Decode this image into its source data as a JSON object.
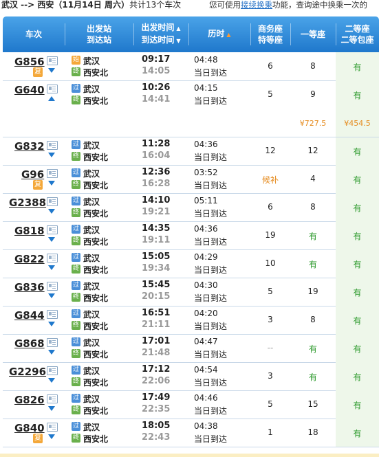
{
  "header": {
    "route_title": "武汉 --> 西安（11月14日 周六）",
    "count_text": "共计13个车次",
    "tip_prefix": "您可使用",
    "tip_link": "接续换乘",
    "tip_suffix": "功能，查询途中换乘一次的"
  },
  "columns": {
    "train": "车次",
    "from": "出发站",
    "to": "到达站",
    "dep_time": "出发时间",
    "arr_time": "到达时间",
    "duration": "历时",
    "biz1": "商务座",
    "biz2": "特等座",
    "first": "一等座",
    "second1": "二等座",
    "second2": "二等包座"
  },
  "icons": {
    "detail": "detail-doc-icon",
    "expand": "chevron-down-icon",
    "collapse": "chevron-up-icon",
    "fu": "复",
    "guo": "过",
    "shi": "始",
    "zhong": "终"
  },
  "prices": {
    "first": "¥727.5",
    "second": "¥454.5"
  },
  "trains": [
    {
      "no": "G856",
      "fu": true,
      "arrow": "down",
      "start": "始",
      "from": "武汉",
      "to": "西安北",
      "dep": "09:17",
      "arr": "14:05",
      "dur": "04:48",
      "day": "当日到达",
      "biz": "6",
      "bizc": "",
      "one": "8",
      "onec": "",
      "two": "有"
    },
    {
      "no": "G640",
      "fu": false,
      "arrow": "up",
      "start": "过",
      "from": "武汉",
      "to": "西安北",
      "dep": "10:26",
      "arr": "14:41",
      "dur": "04:15",
      "day": "当日到达",
      "biz": "5",
      "bizc": "",
      "one": "9",
      "onec": "",
      "two": "有"
    },
    {
      "no": "G832",
      "fu": false,
      "arrow": "down",
      "start": "过",
      "from": "武汉",
      "to": "西安北",
      "dep": "11:28",
      "arr": "16:04",
      "dur": "04:36",
      "day": "当日到达",
      "biz": "12",
      "bizc": "",
      "one": "12",
      "onec": "",
      "two": "有"
    },
    {
      "no": "G96",
      "fu": true,
      "arrow": "down",
      "start": "过",
      "from": "武汉",
      "to": "西安北",
      "dep": "12:36",
      "arr": "16:28",
      "dur": "03:52",
      "day": "当日到达",
      "biz": "候补",
      "bizc": "orange",
      "one": "4",
      "onec": "",
      "two": "有"
    },
    {
      "no": "G2388",
      "fu": false,
      "arrow": "down",
      "start": "过",
      "from": "武汉",
      "to": "西安北",
      "dep": "14:10",
      "arr": "19:21",
      "dur": "05:11",
      "day": "当日到达",
      "biz": "6",
      "bizc": "",
      "one": "8",
      "onec": "",
      "two": "有"
    },
    {
      "no": "G818",
      "fu": false,
      "arrow": "down",
      "start": "过",
      "from": "武汉",
      "to": "西安北",
      "dep": "14:35",
      "arr": "19:11",
      "dur": "04:36",
      "day": "当日到达",
      "biz": "19",
      "bizc": "",
      "one": "有",
      "onec": "green",
      "two": "有"
    },
    {
      "no": "G822",
      "fu": false,
      "arrow": "down",
      "start": "过",
      "from": "武汉",
      "to": "西安北",
      "dep": "15:05",
      "arr": "19:34",
      "dur": "04:29",
      "day": "当日到达",
      "biz": "10",
      "bizc": "",
      "one": "有",
      "onec": "green",
      "two": "有"
    },
    {
      "no": "G836",
      "fu": false,
      "arrow": "down",
      "start": "过",
      "from": "武汉",
      "to": "西安北",
      "dep": "15:45",
      "arr": "20:15",
      "dur": "04:30",
      "day": "当日到达",
      "biz": "5",
      "bizc": "",
      "one": "19",
      "onec": "",
      "two": "有"
    },
    {
      "no": "G844",
      "fu": false,
      "arrow": "down",
      "start": "过",
      "from": "武汉",
      "to": "西安北",
      "dep": "16:51",
      "arr": "21:11",
      "dur": "04:20",
      "day": "当日到达",
      "biz": "3",
      "bizc": "",
      "one": "8",
      "onec": "",
      "two": "有"
    },
    {
      "no": "G868",
      "fu": false,
      "arrow": "down",
      "start": "过",
      "from": "武汉",
      "to": "西安北",
      "dep": "17:01",
      "arr": "21:48",
      "dur": "04:47",
      "day": "当日到达",
      "biz": "--",
      "bizc": "gray",
      "one": "有",
      "onec": "green",
      "two": "有"
    },
    {
      "no": "G2296",
      "fu": false,
      "arrow": "down",
      "start": "过",
      "from": "武汉",
      "to": "西安北",
      "dep": "17:12",
      "arr": "22:06",
      "dur": "04:54",
      "day": "当日到达",
      "biz": "3",
      "bizc": "",
      "one": "有",
      "onec": "green",
      "two": "有"
    },
    {
      "no": "G826",
      "fu": false,
      "arrow": "down",
      "start": "过",
      "from": "武汉",
      "to": "西安北",
      "dep": "17:49",
      "arr": "22:35",
      "dur": "04:46",
      "day": "当日到达",
      "biz": "5",
      "bizc": "",
      "one": "15",
      "onec": "",
      "two": "有"
    },
    {
      "no": "G840",
      "fu": true,
      "arrow": "down",
      "start": "过",
      "from": "武汉",
      "to": "西安北",
      "dep": "18:05",
      "arr": "22:43",
      "dur": "04:38",
      "day": "当日到达",
      "biz": "1",
      "bizc": "",
      "one": "18",
      "onec": "",
      "two": "有"
    }
  ]
}
